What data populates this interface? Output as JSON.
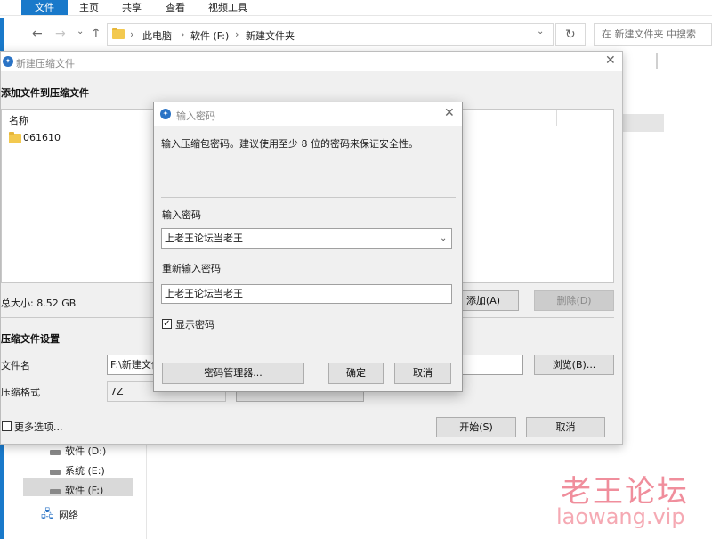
{
  "explorer": {
    "ribbon_tabs": [
      "文件",
      "主页",
      "共享",
      "查看",
      "视频工具"
    ],
    "breadcrumb": [
      "此电脑",
      "软件 (F:)",
      "新建文件夹"
    ],
    "search_placeholder": "在 新建文件夹 中搜索",
    "nav_items": [
      "软件 (D:)",
      "系统 (E:)",
      "软件 (F:)",
      "网络"
    ]
  },
  "archive_window": {
    "title": "新建压缩文件",
    "section_add": "添加文件到压缩文件",
    "list_header": "名称",
    "files": [
      "061610"
    ],
    "total_size": "总大小: 8.52 GB",
    "add_button": "添加(A)",
    "delete_button": "删除(D)",
    "section_settings": "压缩文件设置",
    "filename_label": "文件名",
    "filename_value": "F:\\新建文件",
    "browse_button": "浏览(B)...",
    "format_label": "压缩格式",
    "format_value": "7Z",
    "more_options": "更多选项...",
    "start_button": "开始(S)",
    "cancel_button": "取消"
  },
  "password_dialog": {
    "title": "输入密码",
    "description": "输入压缩包密码。建议使用至少 8 位的密码来保证安全性。",
    "password_label": "输入密码",
    "password_value": "上老王论坛当老王",
    "repeat_label": "重新输入密码",
    "repeat_value": "上老王论坛当老王",
    "show_password_label": "显示密码",
    "show_password_checked": true,
    "manager_button": "密码管理器...",
    "ok_button": "确定",
    "cancel_button": "取消"
  },
  "watermark": {
    "line1": "老王论坛",
    "line2": "laowang.vip"
  },
  "colors": {
    "accent": "#1979ca",
    "watermark": "#f08e9c"
  }
}
